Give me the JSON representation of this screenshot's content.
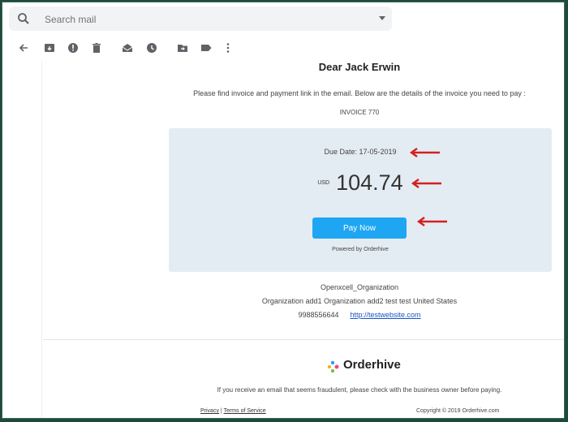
{
  "search": {
    "placeholder": "Search mail"
  },
  "toolbar": {
    "icons": [
      "back-arrow-icon",
      "archive-icon",
      "report-spam-icon",
      "delete-icon",
      "mark-read-icon",
      "snooze-icon",
      "move-to-icon",
      "label-icon",
      "more-vert-icon"
    ]
  },
  "email": {
    "greeting": "Dear Jack Erwin",
    "intro": "Please find invoice and payment link in the email. Below are the details of the invoice you need to pay :",
    "invoice_number": "INVOICE 770",
    "due_label": "Due Date:",
    "due_date": "17-05-2019",
    "currency": "USD",
    "amount": "104.74",
    "pay_button": "Pay Now",
    "powered_by": "Powered by Orderhive",
    "org_name": "Openxcell_Organization",
    "org_address": "Organization add1 Organization add2 test test United States",
    "phone": "9988556644",
    "website": "http://testwebsite.com",
    "logo_text": "Orderhive",
    "fraud_notice": "If you receive an email that seems fraudulent, please check with the business owner before paying.",
    "privacy": "Privacy",
    "separator": "|",
    "terms": "Terms of Service",
    "copyright": "Copyright © 2019 Orderhive.com"
  },
  "colors": {
    "pay_button": "#1ea6f3",
    "panel_bg": "#e4ecf3",
    "annotation_arrow": "#d42020",
    "link": "#1a55c4"
  }
}
